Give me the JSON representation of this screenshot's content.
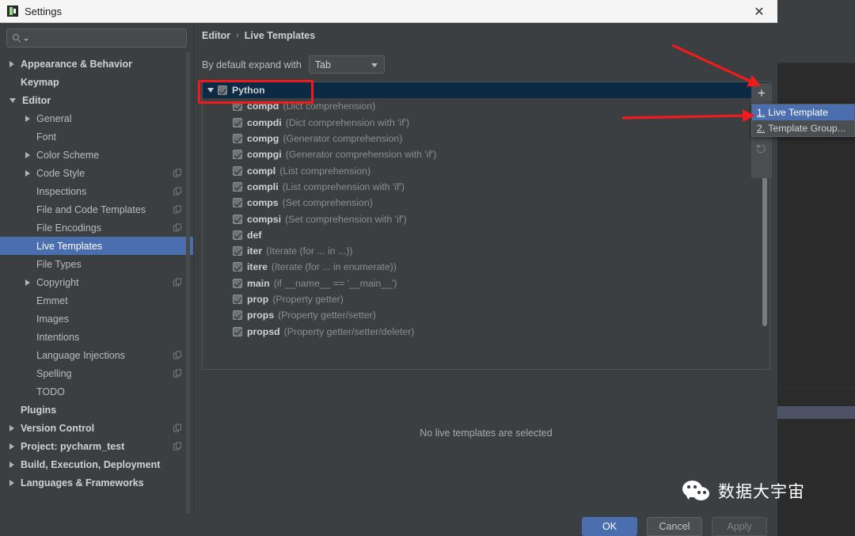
{
  "window": {
    "title": "Settings",
    "icon": "pycharm-icon",
    "close_label": "✕"
  },
  "sidebar": {
    "search": {
      "placeholder": "",
      "value": "",
      "icon": "search-icon"
    },
    "items": [
      {
        "label": "Appearance & Behavior",
        "indent": 0,
        "arrow": "right",
        "bold": true,
        "cfg": false
      },
      {
        "label": "Keymap",
        "indent": 0,
        "arrow": "none",
        "bold": true,
        "cfg": false
      },
      {
        "label": "Editor",
        "indent": 0,
        "arrow": "down",
        "bold": true,
        "cfg": false
      },
      {
        "label": "General",
        "indent": 1,
        "arrow": "right",
        "bold": false,
        "cfg": false
      },
      {
        "label": "Font",
        "indent": 1,
        "arrow": "none",
        "bold": false,
        "cfg": false
      },
      {
        "label": "Color Scheme",
        "indent": 1,
        "arrow": "right",
        "bold": false,
        "cfg": false
      },
      {
        "label": "Code Style",
        "indent": 1,
        "arrow": "right",
        "bold": false,
        "cfg": true
      },
      {
        "label": "Inspections",
        "indent": 1,
        "arrow": "none",
        "bold": false,
        "cfg": true
      },
      {
        "label": "File and Code Templates",
        "indent": 1,
        "arrow": "none",
        "bold": false,
        "cfg": true
      },
      {
        "label": "File Encodings",
        "indent": 1,
        "arrow": "none",
        "bold": false,
        "cfg": true
      },
      {
        "label": "Live Templates",
        "indent": 1,
        "arrow": "none",
        "bold": false,
        "cfg": false,
        "selected": true
      },
      {
        "label": "File Types",
        "indent": 1,
        "arrow": "none",
        "bold": false,
        "cfg": false
      },
      {
        "label": "Copyright",
        "indent": 1,
        "arrow": "right",
        "bold": false,
        "cfg": true
      },
      {
        "label": "Emmet",
        "indent": 1,
        "arrow": "none",
        "bold": false,
        "cfg": false
      },
      {
        "label": "Images",
        "indent": 1,
        "arrow": "none",
        "bold": false,
        "cfg": false
      },
      {
        "label": "Intentions",
        "indent": 1,
        "arrow": "none",
        "bold": false,
        "cfg": false
      },
      {
        "label": "Language Injections",
        "indent": 1,
        "arrow": "none",
        "bold": false,
        "cfg": true
      },
      {
        "label": "Spelling",
        "indent": 1,
        "arrow": "none",
        "bold": false,
        "cfg": true
      },
      {
        "label": "TODO",
        "indent": 1,
        "arrow": "none",
        "bold": false,
        "cfg": false
      },
      {
        "label": "Plugins",
        "indent": 0,
        "arrow": "none",
        "bold": true,
        "cfg": false
      },
      {
        "label": "Version Control",
        "indent": 0,
        "arrow": "right",
        "bold": true,
        "cfg": true
      },
      {
        "label": "Project: pycharm_test",
        "indent": 0,
        "arrow": "right",
        "bold": true,
        "cfg": true
      },
      {
        "label": "Build, Execution, Deployment",
        "indent": 0,
        "arrow": "right",
        "bold": true,
        "cfg": false
      },
      {
        "label": "Languages & Frameworks",
        "indent": 0,
        "arrow": "right",
        "bold": true,
        "cfg": false
      }
    ],
    "help_label": "?"
  },
  "main": {
    "breadcrumb": {
      "parent": "Editor",
      "separator": "›",
      "current": "Live Templates"
    },
    "expand": {
      "label": "By default expand with",
      "value": "Tab"
    },
    "group": {
      "name": "Python",
      "checked": true,
      "expanded": true
    },
    "templates": [
      {
        "key": "compd",
        "desc": "(Dict comprehension)",
        "checked": true
      },
      {
        "key": "compdi",
        "desc": "(Dict comprehension with 'if')",
        "checked": true
      },
      {
        "key": "compg",
        "desc": "(Generator comprehension)",
        "checked": true
      },
      {
        "key": "compgi",
        "desc": "(Generator comprehension with 'if')",
        "checked": true
      },
      {
        "key": "compl",
        "desc": "(List comprehension)",
        "checked": true
      },
      {
        "key": "compli",
        "desc": "(List comprehension with 'if')",
        "checked": true
      },
      {
        "key": "comps",
        "desc": "(Set comprehension)",
        "checked": true
      },
      {
        "key": "compsi",
        "desc": "(Set comprehension with 'if')",
        "checked": true
      },
      {
        "key": "def",
        "desc": "",
        "checked": true
      },
      {
        "key": "iter",
        "desc": "(Iterate (for ... in ...))",
        "checked": true
      },
      {
        "key": "itere",
        "desc": "(Iterate (for ... in enumerate))",
        "checked": true
      },
      {
        "key": "main",
        "desc": "(if __name__ == '__main__')",
        "checked": true
      },
      {
        "key": "prop",
        "desc": "(Property getter)",
        "checked": true
      },
      {
        "key": "props",
        "desc": "(Property getter/setter)",
        "checked": true
      },
      {
        "key": "propsd",
        "desc": "(Property getter/setter/deleter)",
        "checked": true
      }
    ],
    "toolbar": {
      "add_label": "+",
      "undo_icon": "undo-arrow-icon"
    },
    "dropdown": {
      "items": [
        {
          "num": "1.",
          "label": "Live Template",
          "active": true
        },
        {
          "num": "2.",
          "label": "Template Group...",
          "active": false
        }
      ]
    },
    "empty_message": "No live templates are selected"
  },
  "buttons": {
    "ok": "OK",
    "cancel": "Cancel",
    "apply": "Apply"
  },
  "annotations": {
    "highlight_color": "#ee1c1c",
    "arrow_count": 2
  },
  "watermark": {
    "text": "数据大宇宙",
    "logo": "wechat-logo"
  }
}
